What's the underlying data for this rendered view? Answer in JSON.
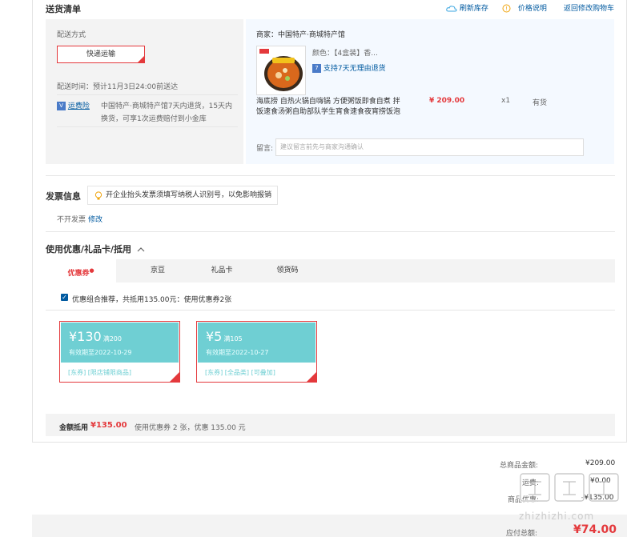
{
  "header": {
    "title": "送货清单",
    "refresh": "刷新库存",
    "price_info": "价格说明",
    "back_cart": "返回修改购物车"
  },
  "shipping": {
    "label": "配送方式",
    "method": "快递运输",
    "time_label": "配送时间：预计11月3日24:00前送达",
    "insurance_label": "运费险",
    "insurance_text_1": "中国特产·商城特产馆7天内退货，15天内",
    "insurance_text_2": "换货，可享1次运费赔付到小金库"
  },
  "seller": {
    "label": "商家：中国特产·商城特产馆",
    "color_label": "颜色：【4盒装】香...",
    "return_policy": "支持7天无理由退货",
    "product_name_1": "海底捞 自热火锅自嗨锅 方便粥饭即食自煮 拌",
    "product_name_2": "饭速食汤粥自助部队学生宵食速食夜宵捞饭泡",
    "price": "¥ 209.00",
    "quantity": "x1",
    "stock": "有货",
    "message_label": "留言:",
    "message_placeholder": "建议留言前先与商家沟通确认"
  },
  "invoice": {
    "title": "发票信息",
    "tip": "开企业抬头发票须填写纳税人识别号，以免影响报销",
    "status": "不开发票",
    "modify": "修改"
  },
  "discount": {
    "title": "使用优惠/礼品卡/抵用",
    "tabs": [
      "优惠券",
      "京豆",
      "礼品卡",
      "领货码"
    ],
    "recommend": "优惠组合推荐，共抵用135.00元：使用优惠券2张",
    "coupons": [
      {
        "amount": "¥130",
        "condition": "满200",
        "expiry": "有效期至2022-10-29",
        "tags": "[东券] [限店铺限商品]"
      },
      {
        "amount": "¥5",
        "condition": "满105",
        "expiry": "有效期至2022-10-27",
        "tags": "[东券] [全品类] [可叠加]"
      }
    ],
    "total_label": "金额抵用",
    "total_value": "¥135.00",
    "total_desc": "使用优惠券 2 张，优惠 135.00 元"
  },
  "summary": {
    "goods_total_label": "总商品金额:",
    "goods_total": "¥209.00",
    "freight_label": "运费:",
    "freight": "¥0.00",
    "discount_label": "商品优惠:",
    "discount": "-¥135.00",
    "payable_label": "应付总额:",
    "payable": "¥74.00"
  },
  "watermark": {
    "text": "zhizhizhi.com"
  },
  "colors": {
    "accent_red": "#e4393c",
    "link_blue": "#005aa0",
    "coupon_teal": "#6fcfd3"
  }
}
